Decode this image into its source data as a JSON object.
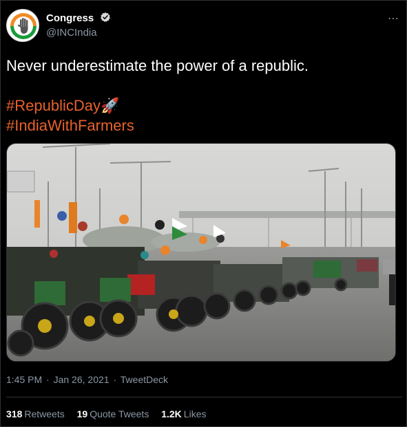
{
  "author": {
    "display_name": "Congress",
    "handle": "@INCIndia",
    "verified": true,
    "avatar_icon": "congress-hand-logo-icon"
  },
  "more_icon": "⋯",
  "tweet": {
    "text": "Never underestimate the power of a republic.",
    "hashtags": [
      "#RepublicDay",
      "#IndiaWithFarmers"
    ],
    "emoji": "🚀"
  },
  "media": {
    "type": "photo",
    "description": "Tractor rally on a foggy highway with Indian flags"
  },
  "meta": {
    "time": "1:45 PM",
    "date": "Jan 26, 2021",
    "source": "TweetDeck",
    "separator": "·"
  },
  "stats": {
    "retweets_count": "318",
    "retweets_label": "Retweets",
    "quotes_count": "19",
    "quotes_label": "Quote Tweets",
    "likes_count": "1.2K",
    "likes_label": "Likes"
  },
  "colors": {
    "background": "#000000",
    "hashtag": "#e8622c",
    "muted": "#8b98a5",
    "verified_badge": "#d9d9d9"
  }
}
